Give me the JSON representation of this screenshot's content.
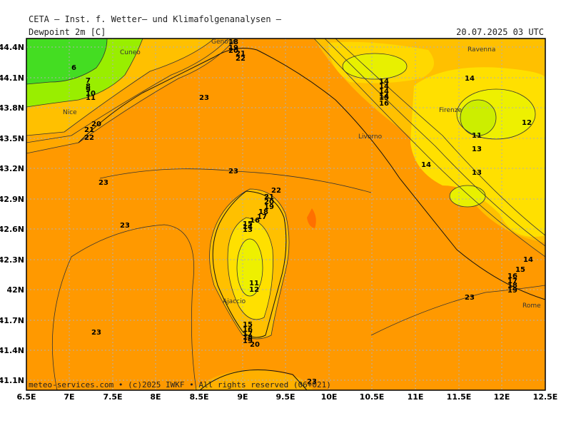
{
  "header": {
    "org_title": "CETA – Inst. f. Wetter– und Klimafolgenanalysen –",
    "parameter": "Dewpoint 2m [C]",
    "valid_time": "20.07.2025 03 UTC"
  },
  "axes": {
    "x_ticks": [
      "6.5E",
      "7E",
      "7.5E",
      "8E",
      "8.5E",
      "9E",
      "9.5E",
      "10E",
      "10.5E",
      "11E",
      "11.5E",
      "12E",
      "12.5E"
    ],
    "y_ticks": [
      "44.4N",
      "44.1N",
      "43.8N",
      "43.5N",
      "43.2N",
      "42.9N",
      "42.6N",
      "42.3N",
      "42N",
      "41.7N",
      "41.4N",
      "41.1N"
    ]
  },
  "cities": [
    "Cuneo",
    "Genova",
    "Ravenna",
    "Nice",
    "Firenze",
    "Livorno",
    "Ajaccio",
    "Rome"
  ],
  "contour_labels": {
    "group_liguria": [
      "18",
      "19",
      "20",
      "21",
      "22"
    ],
    "group_nw": [
      "6",
      "7",
      "8",
      "9",
      "10",
      "11"
    ],
    "group_nice": [
      "20",
      "21",
      "22"
    ],
    "group_apennine": [
      "14",
      "14",
      "14",
      "14",
      "15",
      "16"
    ],
    "group_corsica_north": [
      "22",
      "21",
      "20",
      "19",
      "18",
      "17",
      "16",
      "15",
      "14",
      "13"
    ],
    "group_corsica_south": [
      "15",
      "16",
      "17",
      "18",
      "19",
      "20"
    ],
    "group_rome": [
      "14",
      "15",
      "16",
      "17",
      "18",
      "19"
    ],
    "singles": [
      "23",
      "23",
      "23",
      "23",
      "23",
      "23",
      "23",
      "11",
      "12",
      "14",
      "13",
      "13",
      "14",
      "11",
      "12"
    ]
  },
  "credit": "meteo-services.com • (c)2025 IWKF • All rights reserved (06+021)",
  "colors": {
    "sea_land_23": "#ff9900",
    "level_20": "#ffa800",
    "level_17": "#ffc000",
    "level_14": "#ffe000",
    "level_12": "#ccee00",
    "level_10": "#99ee00",
    "level_8": "#33dd22",
    "frame": "#000000",
    "grid": "#b0b0b0"
  },
  "legend_icons": [
    "map-grid",
    "contour-lines",
    "coastline"
  ]
}
